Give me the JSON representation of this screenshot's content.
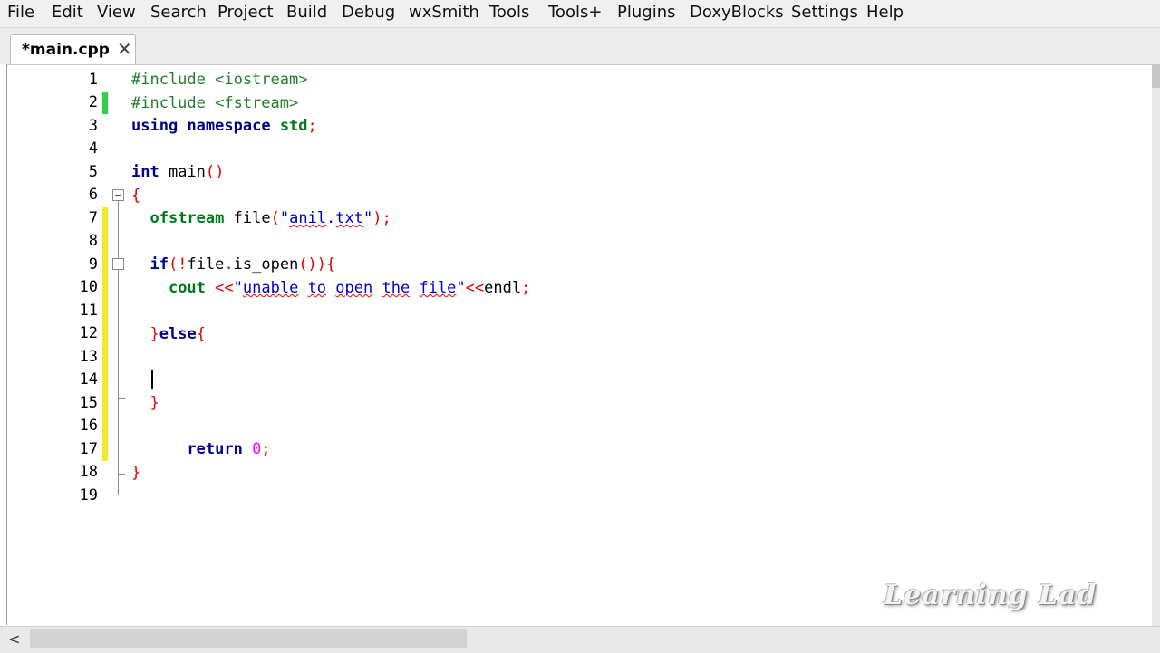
{
  "menu": [
    "File",
    "Edit",
    "View",
    "Search",
    "Project",
    "Build",
    "Debug",
    "wxSmith",
    "Tools",
    "Tools+",
    "Plugins",
    "DoxyBlocks",
    "Settings",
    "Help"
  ],
  "tab": {
    "label": "*main.cpp",
    "close": "✕"
  },
  "line_numbers": [
    "1",
    "2",
    "3",
    "4",
    "5",
    "6",
    "7",
    "8",
    "9",
    "10",
    "11",
    "12",
    "13",
    "14",
    "15",
    "16",
    "17",
    "18",
    "19"
  ],
  "code": {
    "l1": "#include <iostream>",
    "l2": "#include <fstream>",
    "l3_kw1": "using",
    "l3_kw2": "namespace",
    "l3_ns": "std",
    "l3_semi": ";",
    "l5_kw": "int",
    "l5_name": "main",
    "l5_parens": "()",
    "l6_brace": "{",
    "l7_type": "ofstream",
    "l7_var": "file",
    "l7_open": "(",
    "l7_str_q1": "\"",
    "l7_str_a": "anil",
    "l7_str_dot": ".",
    "l7_str_b": "txt",
    "l7_str_q2": "\"",
    "l7_close": ");",
    "l9_kw": "if",
    "l9_op1": "(!",
    "l9_id": "file",
    "l9_dot": ".",
    "l9_fn": "is_open",
    "l9_op2": "()){",
    "l10_kw": "cout",
    "l10_op1": "<<",
    "l10_q1": "\"",
    "l10_w1": "unable",
    "l10_w2": "to",
    "l10_w3": "open",
    "l10_w4": "the",
    "l10_w5": "file",
    "l10_q2": "\"",
    "l10_op2": "<<",
    "l10_id": "endl",
    "l10_semi": ";",
    "l12_op": "}",
    "l12_kw": "else",
    "l12_brace": "{",
    "l15_brace": "}",
    "l17_kw": "return",
    "l17_num": "0",
    "l17_semi": ";",
    "l18_brace": "}"
  },
  "watermark": "Learning Lad",
  "scroll_left": "<",
  "colors": {
    "keyword": "#00008b",
    "preprocessor": "#20802a",
    "string": "#0000c8",
    "operator": "#e00000",
    "number": "#ff00ff",
    "saved_change": "#2fd14a",
    "unsaved_change": "#f5e82a"
  }
}
